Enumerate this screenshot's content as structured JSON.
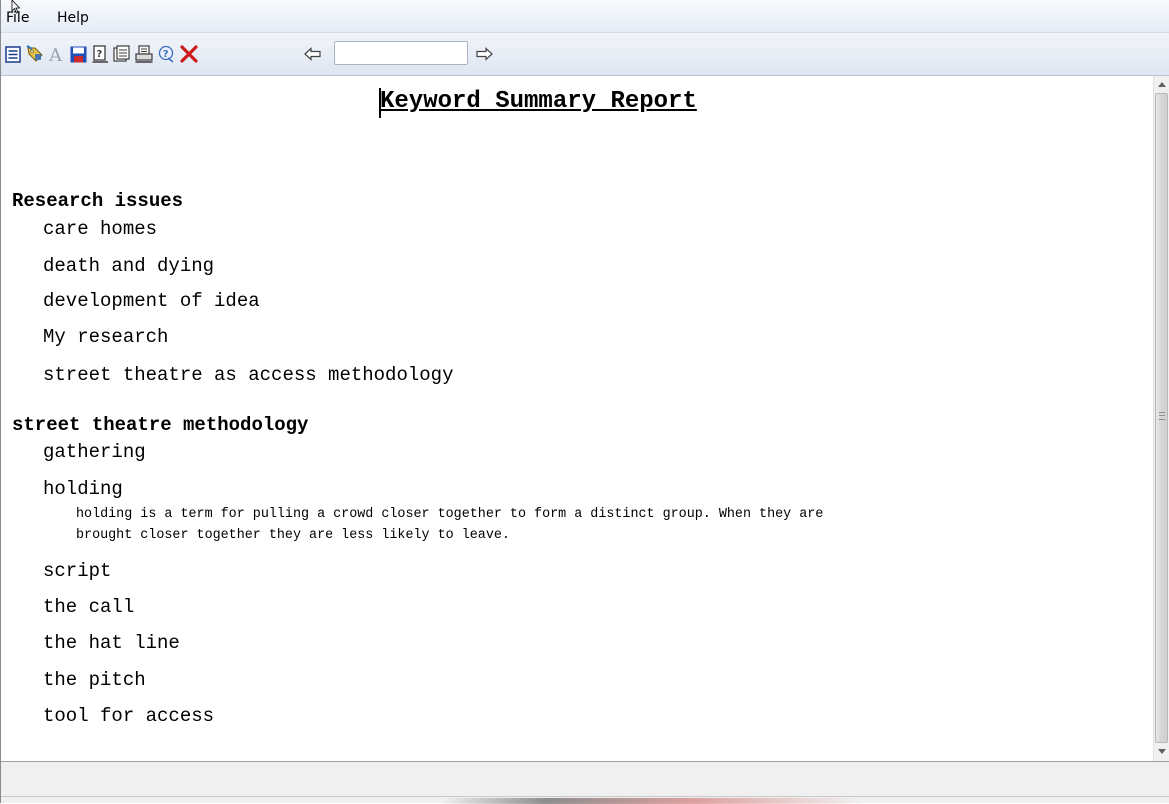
{
  "menubar": {
    "items": [
      {
        "label": "File"
      },
      {
        "label": "Help"
      }
    ]
  },
  "toolbar": {
    "buttons": [
      {
        "icon": "report-list-icon",
        "color": "#1a3c8c"
      },
      {
        "icon": "keyword-tag-icon",
        "color": "#2f6fbf"
      },
      {
        "icon": "font-icon",
        "color": "#9aa4b3"
      },
      {
        "icon": "save-icon",
        "color": "#1f4fb8"
      },
      {
        "icon": "help-book-icon",
        "color": "#3c3c3c"
      },
      {
        "icon": "notes-icon",
        "color": "#3c3c3c"
      },
      {
        "icon": "print-icon",
        "color": "#3c3c3c"
      },
      {
        "icon": "help-icon",
        "color": "#3a6fbf"
      },
      {
        "icon": "close-icon",
        "color": "#cc1b1b"
      },
      {
        "icon": "arrow-left-icon",
        "color": "#444444"
      },
      {
        "icon": "arrow-right-icon",
        "color": "#444444"
      }
    ],
    "nav_input_value": ""
  },
  "report": {
    "title": "Keyword Summary Report",
    "categories": [
      {
        "name": "Research issues",
        "keywords": [
          {
            "label": "care homes"
          },
          {
            "label": "death and dying"
          },
          {
            "label": "development of idea"
          },
          {
            "label": "My research"
          },
          {
            "label": "street theatre as access methodology"
          }
        ]
      },
      {
        "name": "street theatre methodology",
        "keywords": [
          {
            "label": "gathering"
          },
          {
            "label": "holding",
            "note_lines": [
              "holding is a term for pulling a crowd closer together to form a distinct group. When they are",
              "brought closer together they are less likely to leave."
            ]
          },
          {
            "label": "script"
          },
          {
            "label": "the call"
          },
          {
            "label": "the hat line"
          },
          {
            "label": "the pitch"
          },
          {
            "label": "tool for access"
          }
        ]
      }
    ]
  }
}
